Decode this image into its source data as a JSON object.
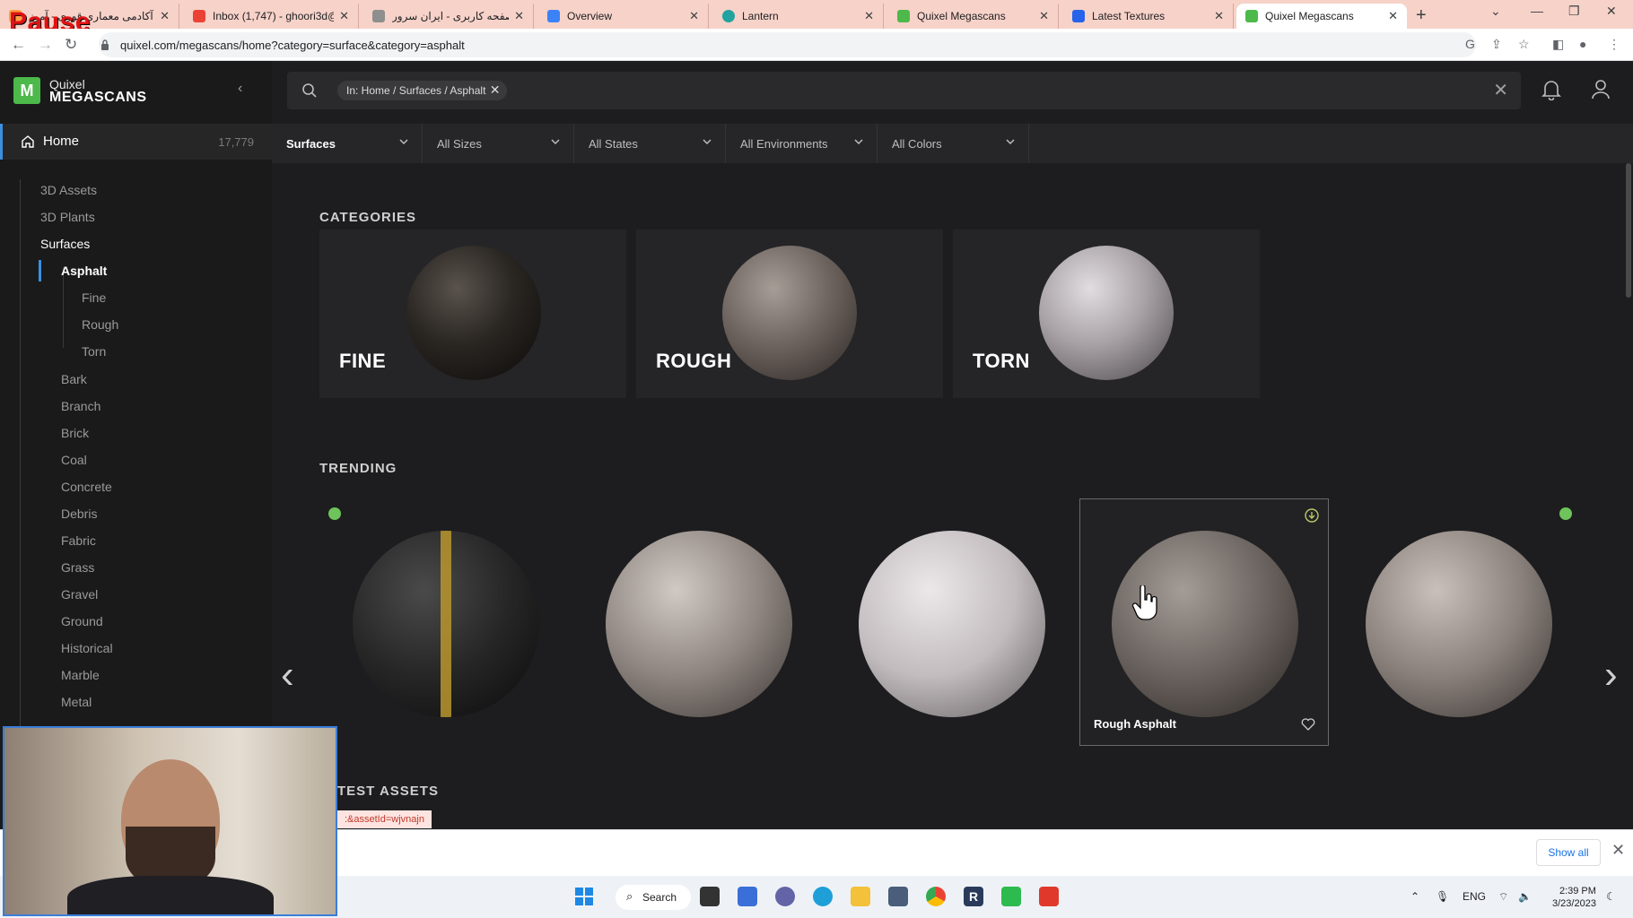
{
  "overlay": {
    "pause_label": "Pause"
  },
  "browser": {
    "tabs": [
      {
        "title": "آکادمی معماری قوری - آموز",
        "favicon": "#ff9f43"
      },
      {
        "title": "Inbox (1,747) - ghoori3d@",
        "favicon": "#ea4335"
      },
      {
        "title": "صفحه کاربری - ایران سرور",
        "favicon": "#8e8e8e"
      },
      {
        "title": "Overview",
        "favicon": "#3b82f6"
      },
      {
        "title": "Lantern",
        "favicon": "#22a39f"
      },
      {
        "title": "Quixel Megascans",
        "favicon": "#4cb94a"
      },
      {
        "title": "Latest Textures",
        "favicon": "#2563eb"
      },
      {
        "title": "Quixel Megascans",
        "favicon": "#4cb94a"
      }
    ],
    "url": "quixel.com/megascans/home?category=surface&category=asphalt"
  },
  "app": {
    "logo": {
      "line1": "Quixel",
      "line2": "MEGASCANS"
    },
    "home": {
      "label": "Home",
      "count": "17,779"
    },
    "nav": {
      "top": [
        "3D Assets",
        "3D Plants"
      ],
      "surfaces": "Surfaces",
      "asphalt": "Asphalt",
      "asphalt_sub": [
        "Fine",
        "Rough",
        "Torn"
      ],
      "others": [
        "Bark",
        "Branch",
        "Brick",
        "Coal",
        "Concrete",
        "Debris",
        "Fabric",
        "Grass",
        "Gravel",
        "Ground",
        "Historical",
        "Marble",
        "Metal"
      ]
    },
    "search": {
      "chip": "In: Home / Surfaces / Asphalt"
    },
    "filters": [
      "Surfaces",
      "All Sizes",
      "All States",
      "All Environments",
      "All Colors"
    ],
    "sections": {
      "categories": "CATEGORIES",
      "trending": "TRENDING",
      "latest": "TEST ASSETS"
    },
    "categories": [
      {
        "label": "FINE",
        "color": "#2a2622"
      },
      {
        "label": "ROUGH",
        "color": "#6f6560"
      },
      {
        "label": "TORN",
        "color": "#a8a2a6"
      }
    ],
    "trending": [
      {
        "name": "",
        "color": "#262626",
        "downloaded": true
      },
      {
        "name": "",
        "color": "#8e8580",
        "downloaded": false
      },
      {
        "name": "",
        "color": "#c2bcbe",
        "downloaded": false
      },
      {
        "name": "Rough Asphalt",
        "color": "#6a625e",
        "downloaded": false
      },
      {
        "name": "",
        "color": "#8a817c",
        "downloaded": true
      }
    ],
    "tooltip": ":&assetId=wjvnajn",
    "accent": "#3b8fe0"
  },
  "downloads": {
    "show_all": "Show all"
  },
  "taskbar": {
    "search": "Search",
    "lang": "ENG",
    "time": "2:39 PM",
    "date": "3/23/2023"
  }
}
